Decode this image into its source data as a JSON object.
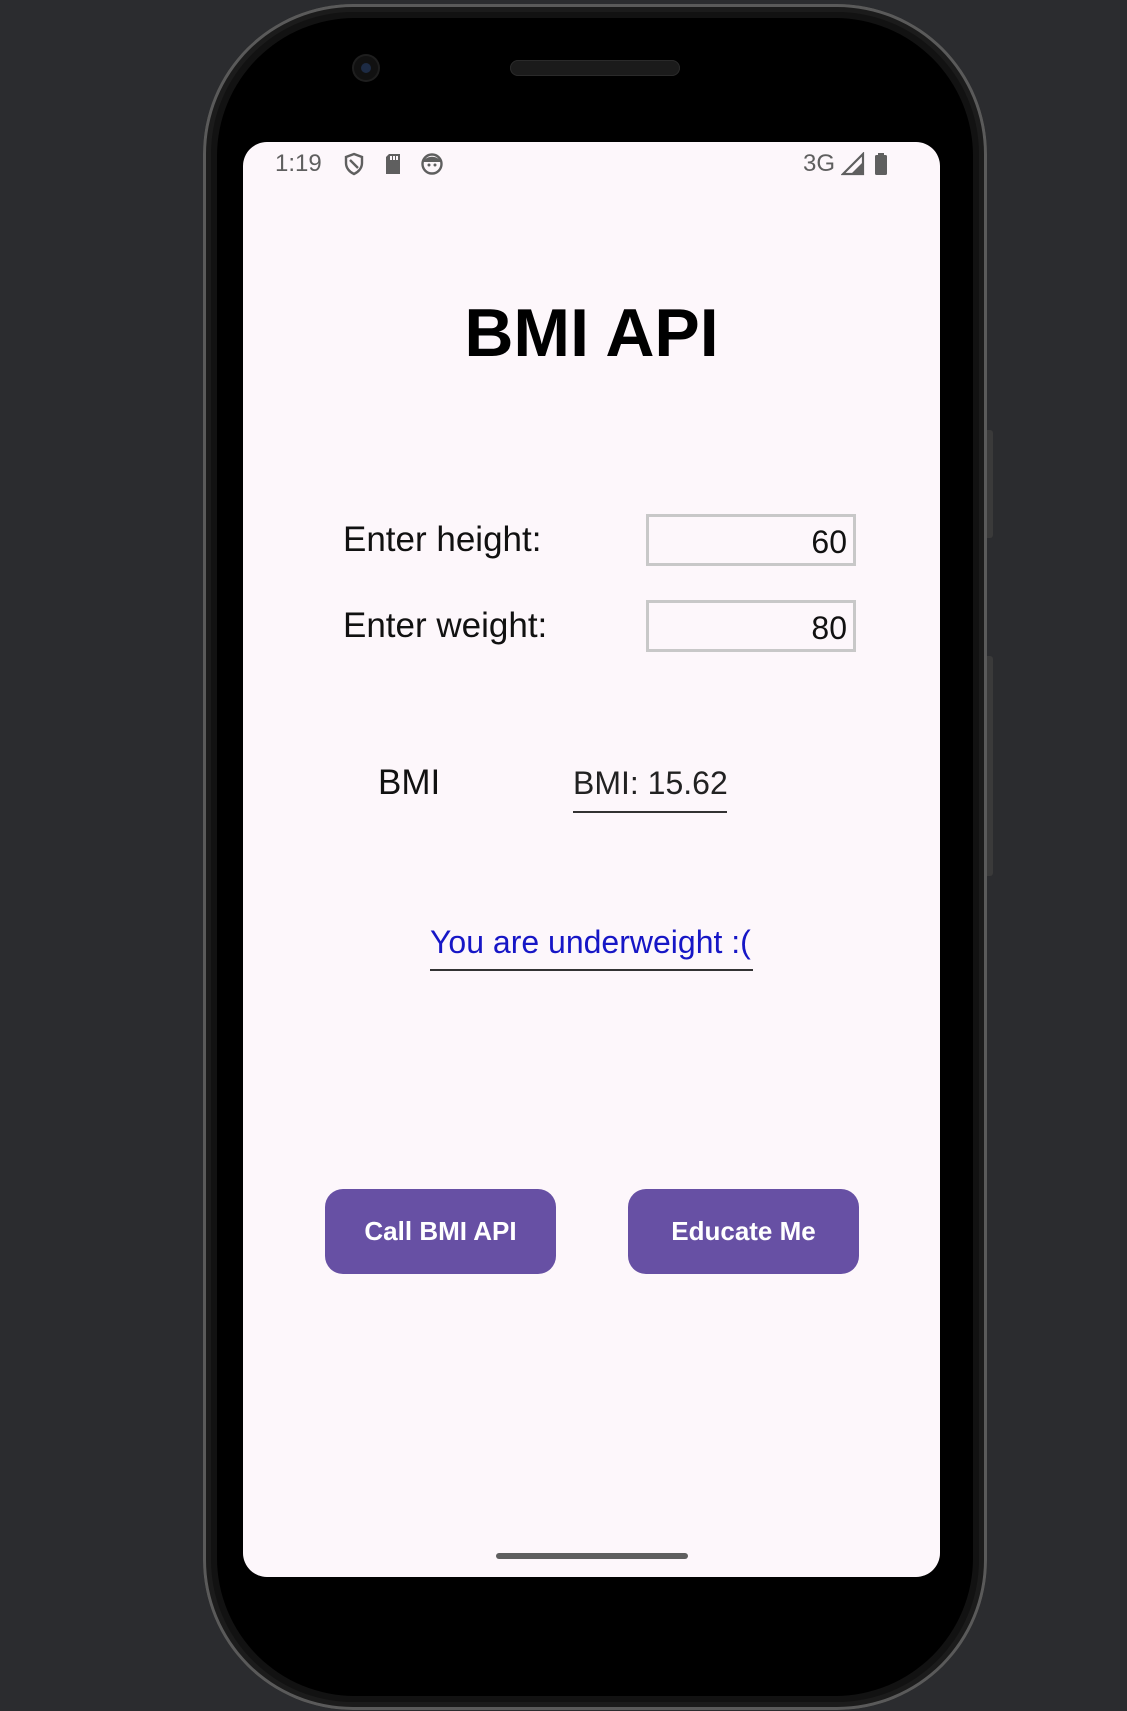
{
  "status_bar": {
    "time": "1:19",
    "network": "3G",
    "icons": [
      "shield-icon",
      "sd-card-icon",
      "face-icon",
      "signal-icon",
      "battery-icon"
    ]
  },
  "app": {
    "title": "BMI API",
    "height_label": "Enter height:",
    "height_value": "60",
    "weight_label": "Enter weight:",
    "weight_value": "80",
    "bmi_label": "BMI",
    "bmi_result": "BMI: 15.62",
    "message": "You are underweight :(",
    "call_button": "Call BMI API",
    "educate_button": "Educate Me"
  },
  "colors": {
    "accent": "#6750a4",
    "message": "#1616c6",
    "background": "#fdf7fb"
  }
}
